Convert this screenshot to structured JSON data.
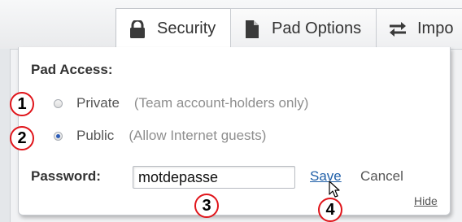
{
  "tabs": [
    {
      "label": "Security",
      "icon": "lock-icon",
      "active": true
    },
    {
      "label": "Pad Options",
      "icon": "document-icon",
      "active": false
    },
    {
      "label": "Impo",
      "icon": "swap-arrows-icon",
      "active": false
    }
  ],
  "panel": {
    "heading": "Pad Access:",
    "options": [
      {
        "label": "Private",
        "hint": "(Team account-holders only)",
        "checked": false
      },
      {
        "label": "Public",
        "hint": "(Allow Internet guests)",
        "checked": true
      }
    ],
    "password_label": "Password:",
    "password_value": "motdepasse",
    "save_label": "Save",
    "cancel_label": "Cancel",
    "hide_label": "Hide"
  },
  "markers": [
    "1",
    "2",
    "3",
    "4"
  ],
  "colors": {
    "marker_ring": "#e0141a",
    "link": "#1f5fa8",
    "radio_selected": "#2b5cb8"
  }
}
